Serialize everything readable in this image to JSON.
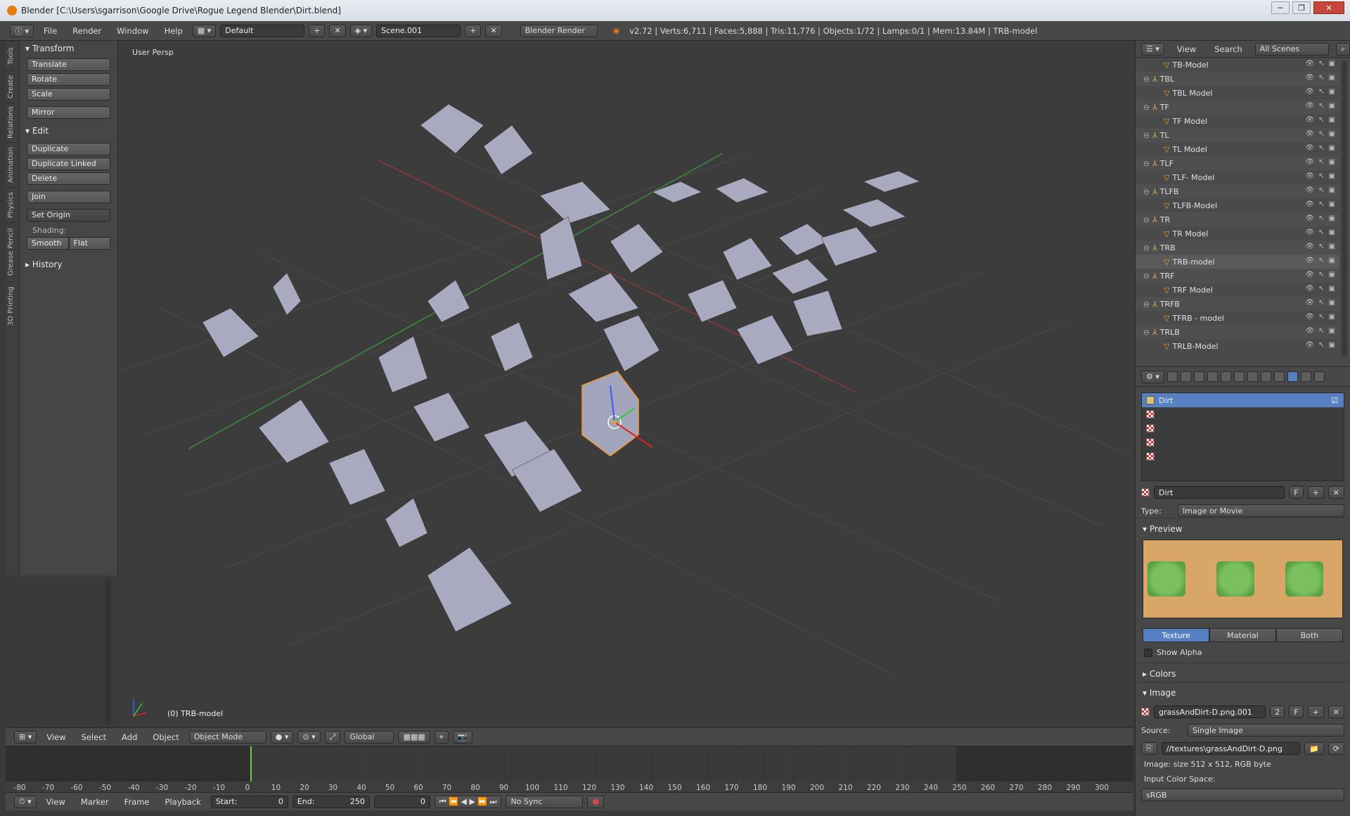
{
  "window": {
    "title": "Blender [C:\\Users\\sgarrison\\Google Drive\\Rogue Legend Blender\\Dirt.blend]",
    "buttons": [
      "─",
      "❐",
      "✕"
    ]
  },
  "info_header": {
    "menus": [
      "File",
      "Render",
      "Window",
      "Help"
    ],
    "layout": "Default",
    "scene": "Scene.001",
    "engine": "Blender Render",
    "stats": "v2.72 | Verts:6,711 | Faces:5,888 | Tris:11,776 | Objects:1/72 | Lamps:0/1 | Mem:13.84M | TRB-model"
  },
  "tool_tabs": [
    "Tools",
    "Create",
    "Relations",
    "Animation",
    "Physics",
    "Grease Pencil",
    "3D Printing"
  ],
  "tool_panel": {
    "transform_title": "Transform",
    "translate": "Translate",
    "rotate": "Rotate",
    "scale": "Scale",
    "mirror": "Mirror",
    "edit_title": "Edit",
    "duplicate": "Duplicate",
    "duplicate_linked": "Duplicate Linked",
    "delete": "Delete",
    "join": "Join",
    "set_origin": "Set Origin",
    "shading_label": "Shading:",
    "smooth": "Smooth",
    "flat": "Flat",
    "history_title": "History"
  },
  "viewport": {
    "title": "User Persp",
    "active_object": "(0) TRB-model"
  },
  "viewport_header": {
    "menus": [
      "View",
      "Select",
      "Add",
      "Object"
    ],
    "mode": "Object Mode",
    "orientation": "Global"
  },
  "timeline": {
    "ticks": [
      "-80",
      "-70",
      "-60",
      "-50",
      "-40",
      "-30",
      "-20",
      "-10",
      "0",
      "10",
      "20",
      "30",
      "40",
      "50",
      "60",
      "70",
      "80",
      "90",
      "100",
      "110",
      "120",
      "130",
      "140",
      "150",
      "160",
      "170",
      "180",
      "190",
      "200",
      "210",
      "220",
      "230",
      "240",
      "250",
      "260",
      "270",
      "280",
      "290",
      "300"
    ],
    "current_frame": 0
  },
  "timeline_header": {
    "menus": [
      "View",
      "Marker",
      "Frame",
      "Playback"
    ],
    "start": "Start:",
    "start_val": "0",
    "end": "End:",
    "end_val": "250",
    "frame_val": "0",
    "sync": "No Sync"
  },
  "outliner": {
    "view": "View",
    "search": "Search",
    "scenes": "All Scenes",
    "rows": [
      {
        "name": "TB-Model",
        "indent": 2
      },
      {
        "name": "TBL",
        "indent": 1
      },
      {
        "name": "TBL Model",
        "indent": 2
      },
      {
        "name": "TF",
        "indent": 1
      },
      {
        "name": "TF Model",
        "indent": 2
      },
      {
        "name": "TL",
        "indent": 1
      },
      {
        "name": "TL Model",
        "indent": 2
      },
      {
        "name": "TLF",
        "indent": 1
      },
      {
        "name": "TLF- Model",
        "indent": 2
      },
      {
        "name": "TLFB",
        "indent": 1
      },
      {
        "name": "TLFB-Model",
        "indent": 2
      },
      {
        "name": "TR",
        "indent": 1
      },
      {
        "name": "TR Model",
        "indent": 2
      },
      {
        "name": "TRB",
        "indent": 1
      },
      {
        "name": "TRB-model",
        "indent": 2
      },
      {
        "name": "TRF",
        "indent": 1
      },
      {
        "name": "TRF Model",
        "indent": 2
      },
      {
        "name": "TRFB",
        "indent": 1
      },
      {
        "name": "TFRB - model",
        "indent": 2
      },
      {
        "name": "TRLB",
        "indent": 1
      },
      {
        "name": "TRLB-Model",
        "indent": 2
      }
    ]
  },
  "properties": {
    "texture_slot": "Dirt",
    "texture_name": "Dirt",
    "texture_users_flag": "F",
    "type_label": "Type:",
    "type_value": "Image or Movie",
    "preview_title": "Preview",
    "seg": [
      "Texture",
      "Material",
      "Both"
    ],
    "show_alpha": "Show Alpha",
    "colors_title": "Colors",
    "image_title": "Image",
    "image_name": "grassAndDirt-D.png.001",
    "image_users": "2",
    "image_flag": "F",
    "source_label": "Source:",
    "source_value": "Single Image",
    "filepath": "//textures\\grassAndDirt-D.png",
    "image_size": "Image: size 512 x 512, RGB byte",
    "color_space_label": "Input Color Space:",
    "color_space": "sRGB"
  },
  "colors": {
    "selection": "#5680c2",
    "active_object_outline": "#f19b31",
    "frame_cursor": "#6bd04e"
  }
}
